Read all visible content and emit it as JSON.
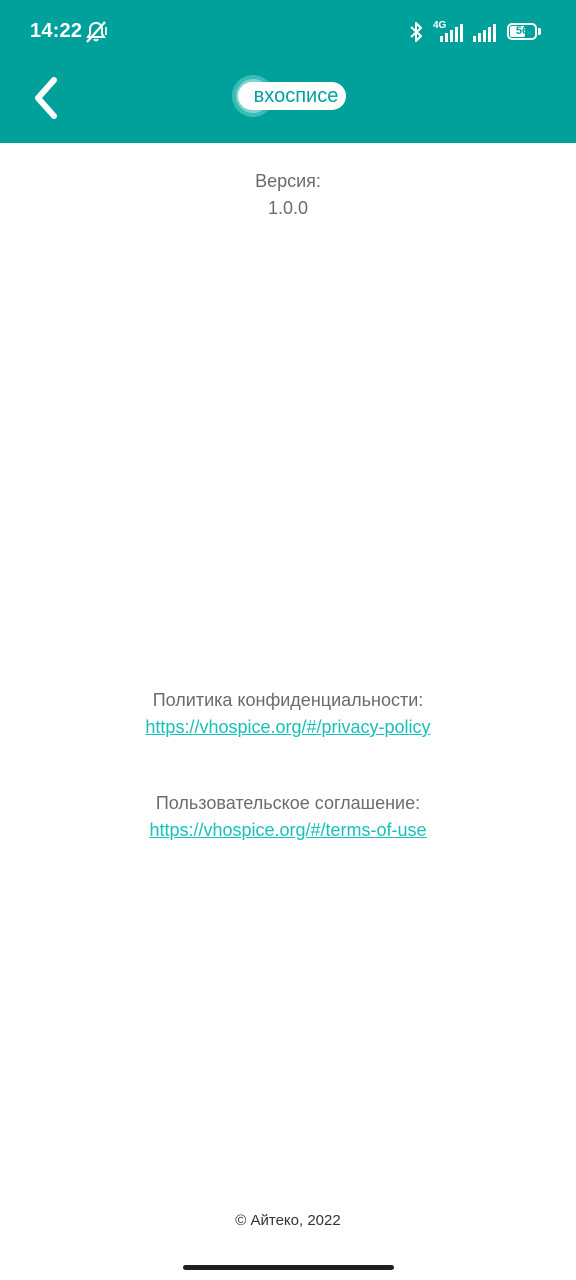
{
  "status_bar": {
    "time": "14:22",
    "network": "4G",
    "battery": "56",
    "icons": [
      "mute-vibrate-icon",
      "bluetooth-icon",
      "signal-icon",
      "signal-icon",
      "battery-icon"
    ]
  },
  "header": {
    "back_icon": "chevron-left-icon",
    "logo_text": "вхосписе",
    "background_color": "#00a19b"
  },
  "version": {
    "label": "Версия:",
    "value": "1.0.0"
  },
  "privacy": {
    "label": "Политика конфиденциальности:",
    "link": "https://vhospice.org/#/privacy-policy"
  },
  "terms": {
    "label": "Пользовательское соглашение:",
    "link": "https://vhospice.org/#/terms-of-use"
  },
  "footer": {
    "copyright": "© Айтеко, 2022"
  },
  "colors": {
    "accent": "#00a19b",
    "link": "#17c0b8",
    "text_muted": "#6b6b6b"
  }
}
